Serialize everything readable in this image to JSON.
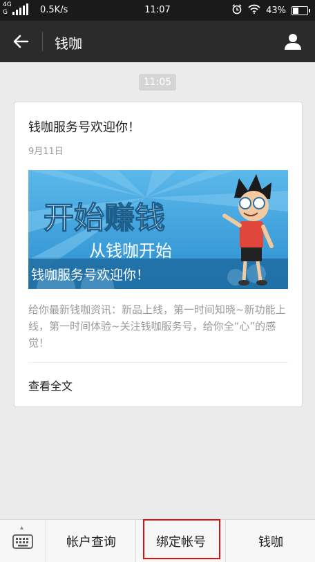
{
  "status_bar": {
    "network_top": "4G",
    "network_bottom": "G",
    "speed": "0.5K/s",
    "time": "11:07",
    "battery": "43%",
    "battery_level": 0.43
  },
  "header": {
    "title": "钱咖"
  },
  "chat": {
    "timestamp": "11:05",
    "card": {
      "title": "钱咖服务号欢迎你！",
      "date": "9月11日",
      "banner": {
        "headline": "开始赚钱",
        "subline": "从钱咖开始",
        "caption": "钱咖服务号欢迎你！"
      },
      "description": "给你最新钱咖资讯：新品上线，第一时间知晓~新功能上线，第一时间体验~关注钱咖服务号，给你全“心”的感觉！",
      "read_more": "查看全文"
    }
  },
  "menu": {
    "items": [
      {
        "label": "帐户查询"
      },
      {
        "label": "绑定帐号"
      },
      {
        "label": "钱咖"
      }
    ]
  },
  "colors": {
    "header_bg": "#2b2b2b",
    "highlight": "#e01010",
    "banner_blue": "#3fa6de"
  }
}
